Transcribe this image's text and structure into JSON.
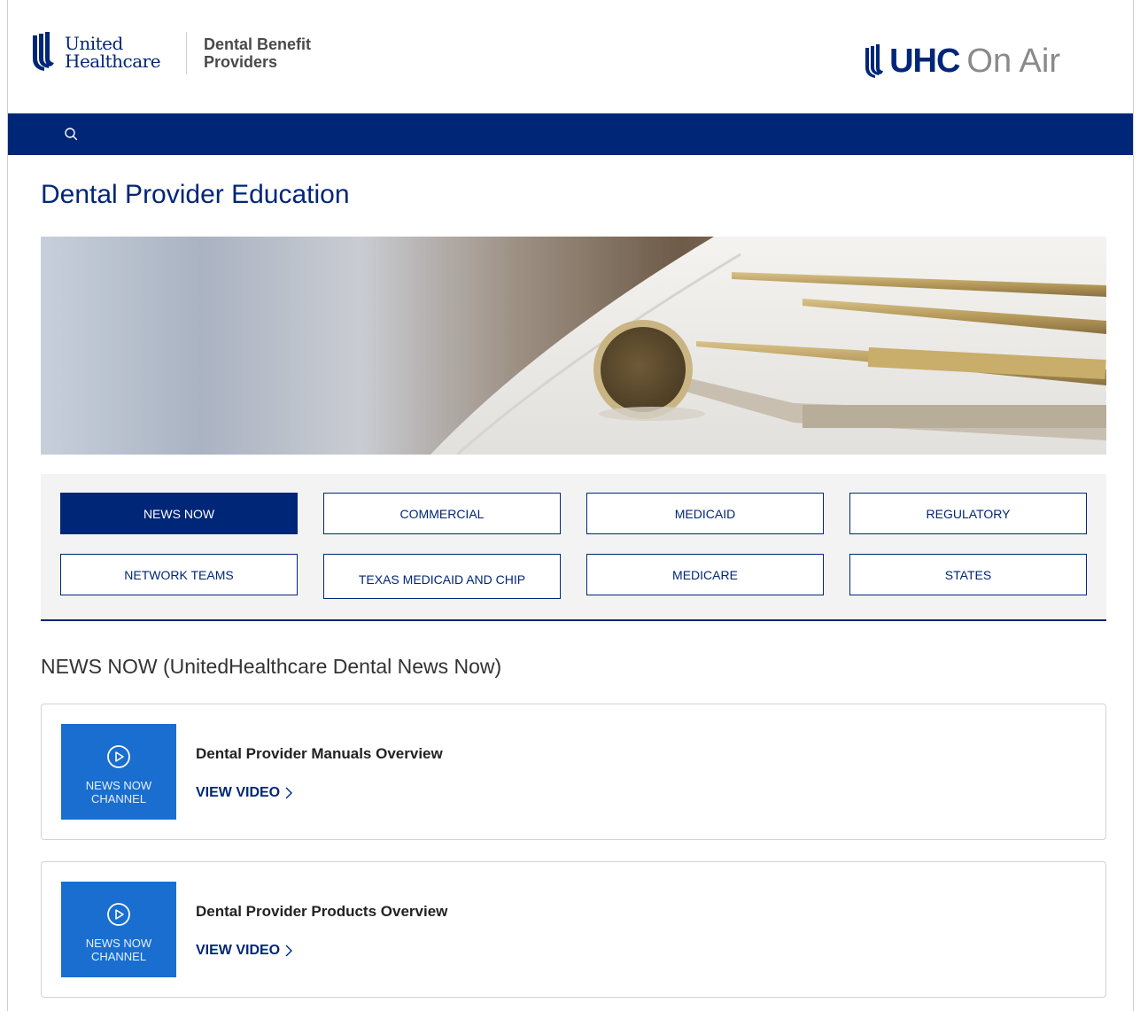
{
  "header": {
    "logo_line1": "United",
    "logo_line2": "Healthcare",
    "dbp_line1": "Dental Benefit",
    "dbp_line2": "Providers",
    "onair_bold": "UHC",
    "onair_light": "On Air"
  },
  "navbar": {
    "search_icon": "search-icon",
    "color": "#002677"
  },
  "page": {
    "title": "Dental Provider Education",
    "hero_alt": "dental-instruments-image"
  },
  "categories": [
    {
      "label": "NEWS NOW",
      "active": true
    },
    {
      "label": "COMMERCIAL",
      "active": false
    },
    {
      "label": "MEDICAID",
      "active": false
    },
    {
      "label": "REGULATORY",
      "active": false
    },
    {
      "label": "NETWORK TEAMS",
      "active": false
    },
    {
      "label": "TEXAS MEDICAID AND CHIP",
      "active": false
    },
    {
      "label": "MEDICARE",
      "active": false
    },
    {
      "label": "STATES",
      "active": false
    }
  ],
  "section": {
    "heading": "NEWS NOW (UnitedHealthcare Dental News Now)"
  },
  "videos": [
    {
      "thumb_line1": "NEWS NOW",
      "thumb_line2": "CHANNEL",
      "title": "Dental Provider Manuals Overview",
      "link": "VIEW VIDEO"
    },
    {
      "thumb_line1": "NEWS NOW",
      "thumb_line2": "CHANNEL",
      "title": "Dental Provider Products Overview",
      "link": "VIEW VIDEO"
    }
  ],
  "colors": {
    "brand_navy": "#002677",
    "thumb_blue": "#196ecf",
    "panel_gray": "#f3f3f3"
  }
}
